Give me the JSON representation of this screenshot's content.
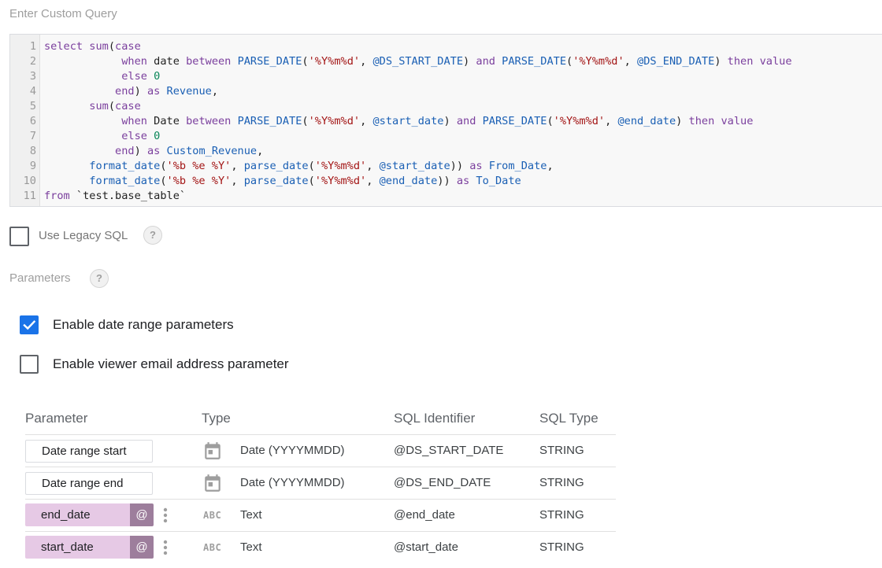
{
  "query_section": {
    "title": "Enter Custom Query",
    "lines": [
      {
        "n": "1",
        "code": "select sum(case"
      },
      {
        "n": "2",
        "code": "            when date between PARSE_DATE('%Y%m%d', @DS_START_DATE) and PARSE_DATE('%Y%m%d', @DS_END_DATE) then value"
      },
      {
        "n": "3",
        "code": "            else 0"
      },
      {
        "n": "4",
        "code": "           end) as Revenue,"
      },
      {
        "n": "5",
        "code": "       sum(case"
      },
      {
        "n": "6",
        "code": "            when Date between PARSE_DATE('%Y%m%d', @start_date) and PARSE_DATE('%Y%m%d', @end_date) then value"
      },
      {
        "n": "7",
        "code": "            else 0"
      },
      {
        "n": "8",
        "code": "           end) as Custom_Revenue,"
      },
      {
        "n": "9",
        "code": "       format_date('%b %e %Y', parse_date('%Y%m%d', @start_date)) as From_Date,"
      },
      {
        "n": "10",
        "code": "       format_date('%b %e %Y', parse_date('%Y%m%d', @end_date)) as To_Date"
      },
      {
        "n": "11",
        "code": "from `test.base_table`"
      }
    ]
  },
  "legacy_sql": {
    "label": "Use Legacy SQL",
    "checked": false,
    "help": "?"
  },
  "parameters_section": {
    "title": "Parameters",
    "help": "?",
    "enable_date_range": {
      "label": "Enable date range parameters",
      "checked": true
    },
    "enable_viewer_email": {
      "label": "Enable viewer email address parameter",
      "checked": false
    }
  },
  "param_table": {
    "headers": {
      "parameter": "Parameter",
      "type": "Type",
      "sql_identifier": "SQL Identifier",
      "sql_type": "SQL Type"
    },
    "rows": [
      {
        "name": "Date range start",
        "custom": false,
        "type_icon": "calendar-icon",
        "type": "Date (YYYYMMDD)",
        "identifier": "@DS_START_DATE",
        "sql_type": "STRING"
      },
      {
        "name": "Date range end",
        "custom": false,
        "type_icon": "calendar-icon",
        "type": "Date (YYYYMMDD)",
        "identifier": "@DS_END_DATE",
        "sql_type": "STRING"
      },
      {
        "name": "end_date",
        "custom": true,
        "at_label": "@",
        "type_icon": "abc-icon",
        "type_icon_text": "ABC",
        "type": "Text",
        "identifier": "@end_date",
        "sql_type": "STRING"
      },
      {
        "name": "start_date",
        "custom": true,
        "at_label": "@",
        "type_icon": "abc-icon",
        "type_icon_text": "ABC",
        "type": "Text",
        "identifier": "@start_date",
        "sql_type": "STRING"
      }
    ]
  },
  "colors": {
    "accent": "#1a73e8",
    "custom_param_bg": "#e6c9e5",
    "custom_param_at": "#9d7e9c"
  }
}
